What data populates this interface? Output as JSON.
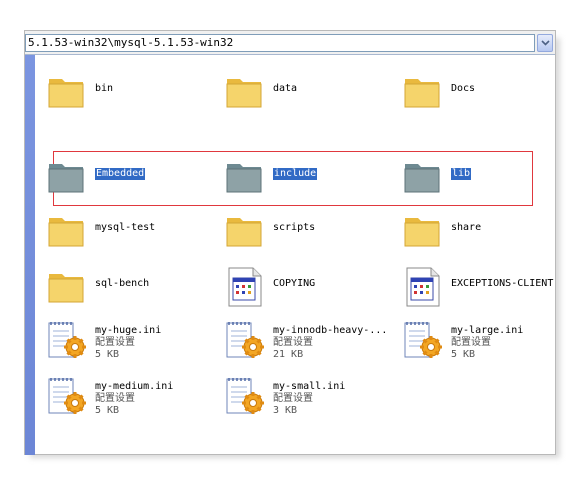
{
  "address": {
    "path": "5.1.53-win32\\mysql-5.1.53-win32"
  },
  "items": [
    {
      "name": "bin",
      "icon": "folder-icon"
    },
    {
      "name": "data",
      "icon": "folder-icon"
    },
    {
      "name": "Docs",
      "icon": "folder-icon"
    },
    {
      "name": "Embedded",
      "icon": "folder-icon",
      "selected": true
    },
    {
      "name": "include",
      "icon": "folder-icon",
      "selected": true
    },
    {
      "name": "lib",
      "icon": "folder-icon",
      "selected": true
    },
    {
      "name": "mysql-test",
      "icon": "folder-icon"
    },
    {
      "name": "scripts",
      "icon": "folder-icon"
    },
    {
      "name": "share",
      "icon": "folder-icon"
    },
    {
      "name": "sql-bench",
      "icon": "folder-icon"
    },
    {
      "name": "COPYING",
      "icon": "document-icon"
    },
    {
      "name": "EXCEPTIONS-CLIENT",
      "icon": "document-icon"
    },
    {
      "name": "my-huge.ini",
      "type": "配置设置",
      "size": "5 KB",
      "icon": "config-file-icon"
    },
    {
      "name": "my-innodb-heavy-...",
      "type": "配置设置",
      "size": "21 KB",
      "icon": "config-file-icon"
    },
    {
      "name": "my-large.ini",
      "type": "配置设置",
      "size": "5 KB",
      "icon": "config-file-icon"
    },
    {
      "name": "my-medium.ini",
      "type": "配置设置",
      "size": "5 KB",
      "icon": "config-file-icon"
    },
    {
      "name": "my-small.ini",
      "type": "配置设置",
      "size": "3 KB",
      "icon": "config-file-icon"
    }
  ],
  "colors": {
    "selection": "#316ac5",
    "highlight_box": "#e0383e",
    "folder": "#f5d46b"
  }
}
